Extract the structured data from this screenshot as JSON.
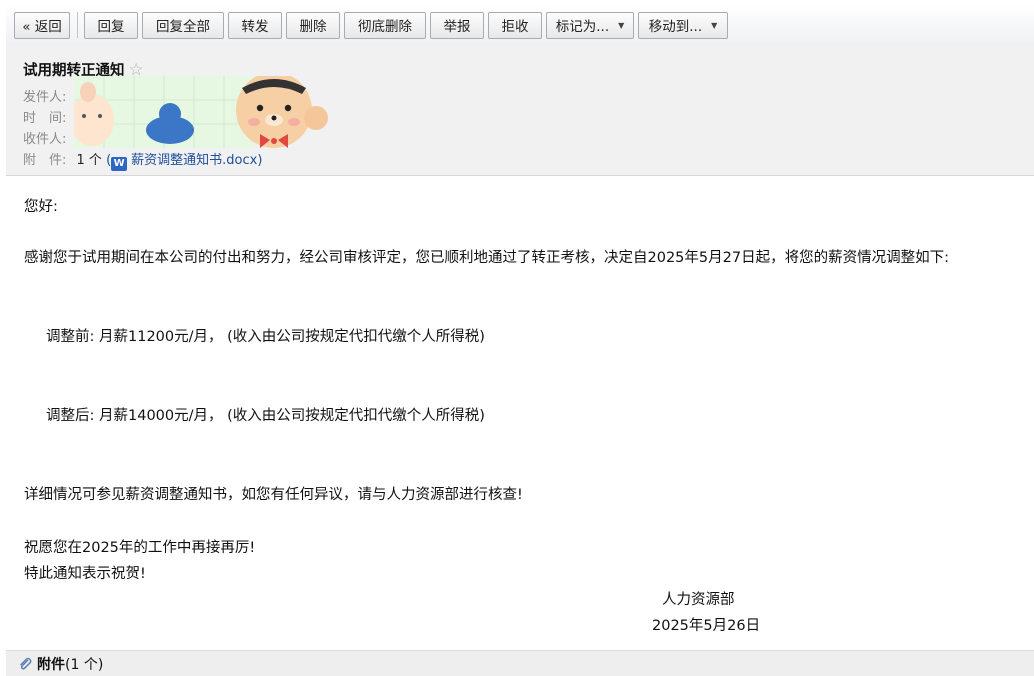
{
  "toolbar": {
    "back": "« 返回",
    "reply": "回复",
    "reply_all": "回复全部",
    "forward": "转发",
    "delete": "删除",
    "delete_permanently": "彻底删除",
    "report": "举报",
    "reject": "拒收",
    "mark_as": "标记为...",
    "move_to": "移动到..."
  },
  "header": {
    "subject": "试用期转正通知",
    "star": "☆",
    "from_label": "发件人:",
    "time_label": "时　间:",
    "to_label": "收件人:",
    "attach_label": "附　件:",
    "attach_count": "1 个",
    "attach_open": "(",
    "attach_close": ")",
    "attach_icon_letter": "W",
    "attach_name": "薪资调整通知书.docx"
  },
  "body": {
    "greeting": "您好:",
    "p1": "感谢您于试用期间在本公司的付出和努力，经公司审核评定，您已顺利地通过了转正考核，决定自2025年5月27日起，将您的薪资情况调整如下:",
    "before": "调整前: 月薪11200元/月，  (收入由公司按规定代扣代缴个人所得税)",
    "after": "调整后: 月薪14000元/月，  (收入由公司按规定代扣代缴个人所得税)",
    "details": "详细情况可参见薪资调整通知书，如您有任何异议，请与人力资源部进行核查!",
    "wish": "祝愿您在2025年的工作中再接再厉!",
    "congrats": "特此通知表示祝贺!",
    "signature_dept": "人力资源部",
    "signature_date": "2025年5月26日"
  },
  "footer": {
    "title": "附件",
    "count": "(1 个)"
  },
  "colors": {
    "link": "#1f4e9a",
    "meta_gray": "#8a8a8a",
    "header_bg": "#f1f1f1"
  }
}
